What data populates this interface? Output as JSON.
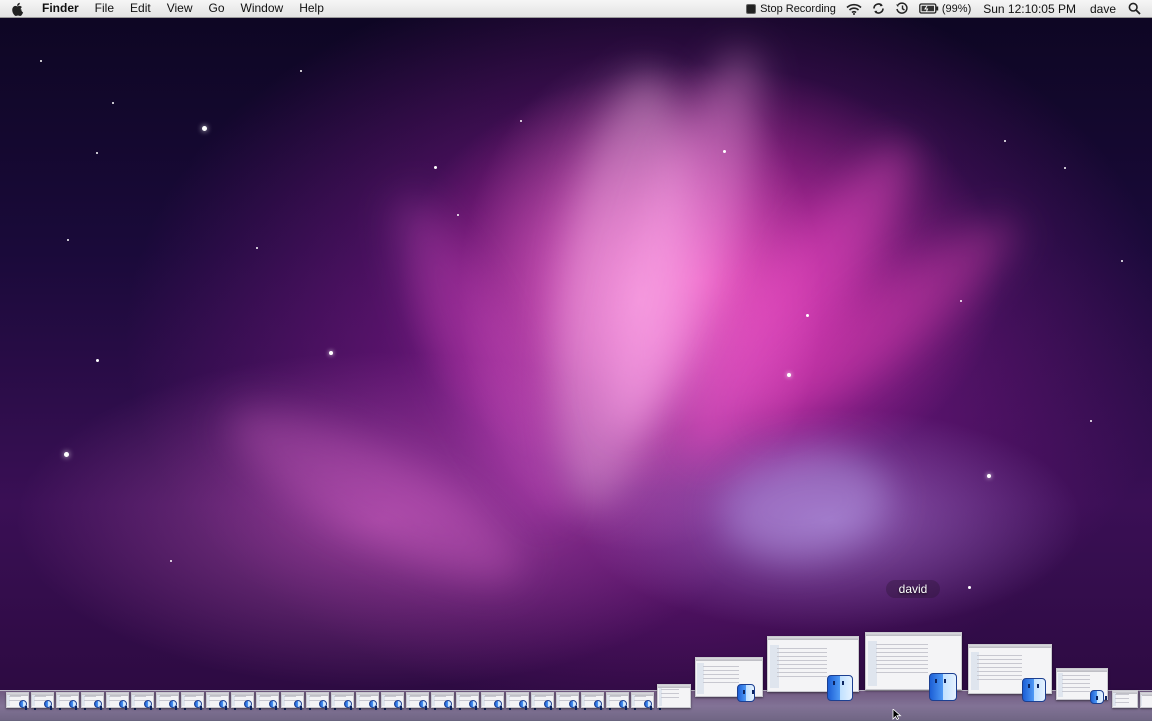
{
  "menubar": {
    "app_name": "Finder",
    "menus": [
      "File",
      "Edit",
      "View",
      "Go",
      "Window",
      "Help"
    ],
    "status": {
      "recording_label": "Stop Recording",
      "battery": "(99%)",
      "clock": "Sun 12:10:05 PM",
      "user": "dave"
    },
    "icons": [
      "apple-icon",
      "stop-recording-icon",
      "wifi-icon",
      "sync-icon",
      "time-machine-icon",
      "battery-icon",
      "spotlight-icon"
    ]
  },
  "dock": {
    "hover_label": "david"
  },
  "colors": {
    "wallpaper_primary": "#ff3cbe",
    "wallpaper_dark": "#12042a",
    "menubar": "#e8e8e8"
  }
}
